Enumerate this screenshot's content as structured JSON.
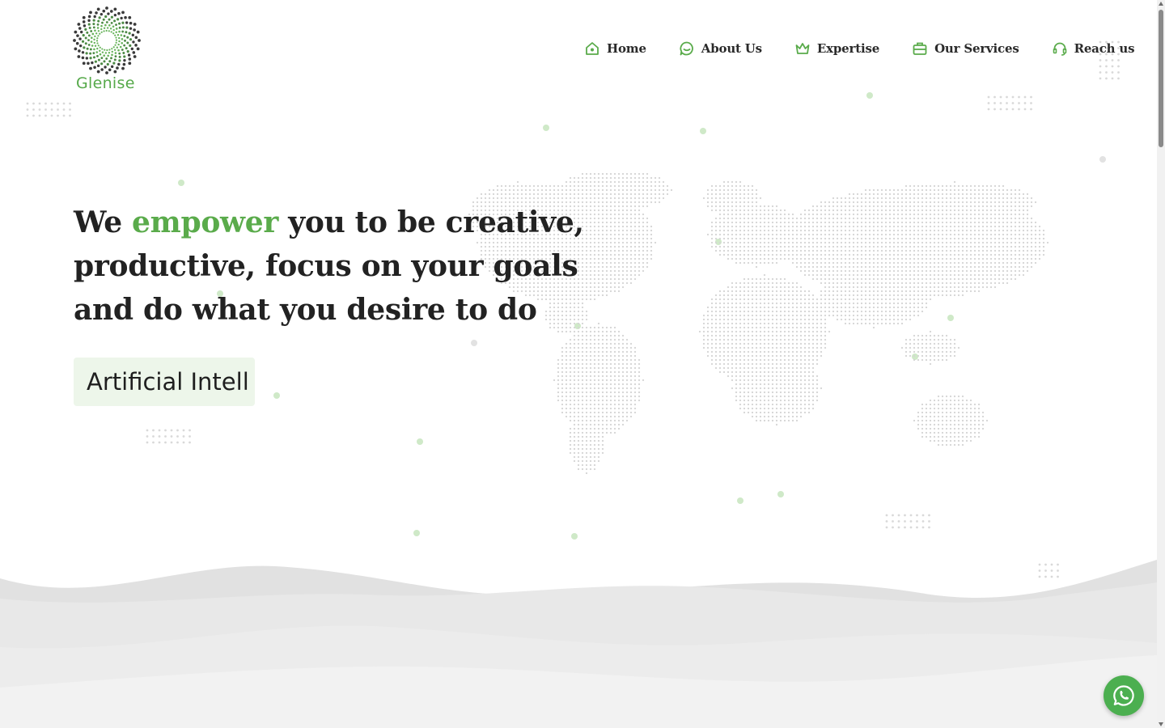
{
  "brand": {
    "name": "Glenise",
    "accent_color": "#5aab4b"
  },
  "nav": {
    "items": [
      {
        "label": "Home",
        "icon": "home-icon"
      },
      {
        "label": "About Us",
        "icon": "chat-icon"
      },
      {
        "label": "Expertise",
        "icon": "crown-icon"
      },
      {
        "label": "Our Services",
        "icon": "briefcase-icon"
      },
      {
        "label": "Reach us",
        "icon": "headset-icon"
      }
    ]
  },
  "hero": {
    "title_pre": "We ",
    "title_accent": "empower",
    "title_post": " you to be creative, productive, focus on your goals and do what you desire to do",
    "typed_text": "Artificial Intell"
  },
  "floating": {
    "whatsapp_icon": "whatsapp-icon"
  }
}
